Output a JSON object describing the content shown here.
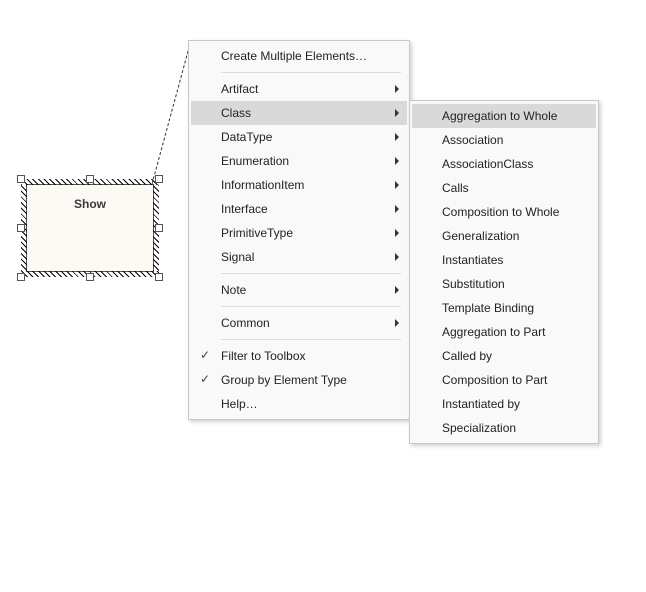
{
  "element": {
    "title": "Show"
  },
  "menu": {
    "create_multiple": "Create Multiple Elements…",
    "artifact": "Artifact",
    "class": "Class",
    "datatype": "DataType",
    "enumeration": "Enumeration",
    "informationitem": "InformationItem",
    "interface": "Interface",
    "primitivetype": "PrimitiveType",
    "signal": "Signal",
    "note": "Note",
    "common": "Common",
    "filter_toolbox": "Filter to Toolbox",
    "group_by_type": "Group by Element Type",
    "help": "Help…"
  },
  "submenu": {
    "aggregation_to_whole": "Aggregation to Whole",
    "association": "Association",
    "associationclass": "AssociationClass",
    "calls": "Calls",
    "composition_to_whole": "Composition to Whole",
    "generalization": "Generalization",
    "instantiates": "Instantiates",
    "substitution": "Substitution",
    "template_binding": "Template Binding",
    "aggregation_to_part": "Aggregation to Part",
    "called_by": "Called by",
    "composition_to_part": "Composition to Part",
    "instantiated_by": "Instantiated by",
    "specialization": "Specialization"
  }
}
